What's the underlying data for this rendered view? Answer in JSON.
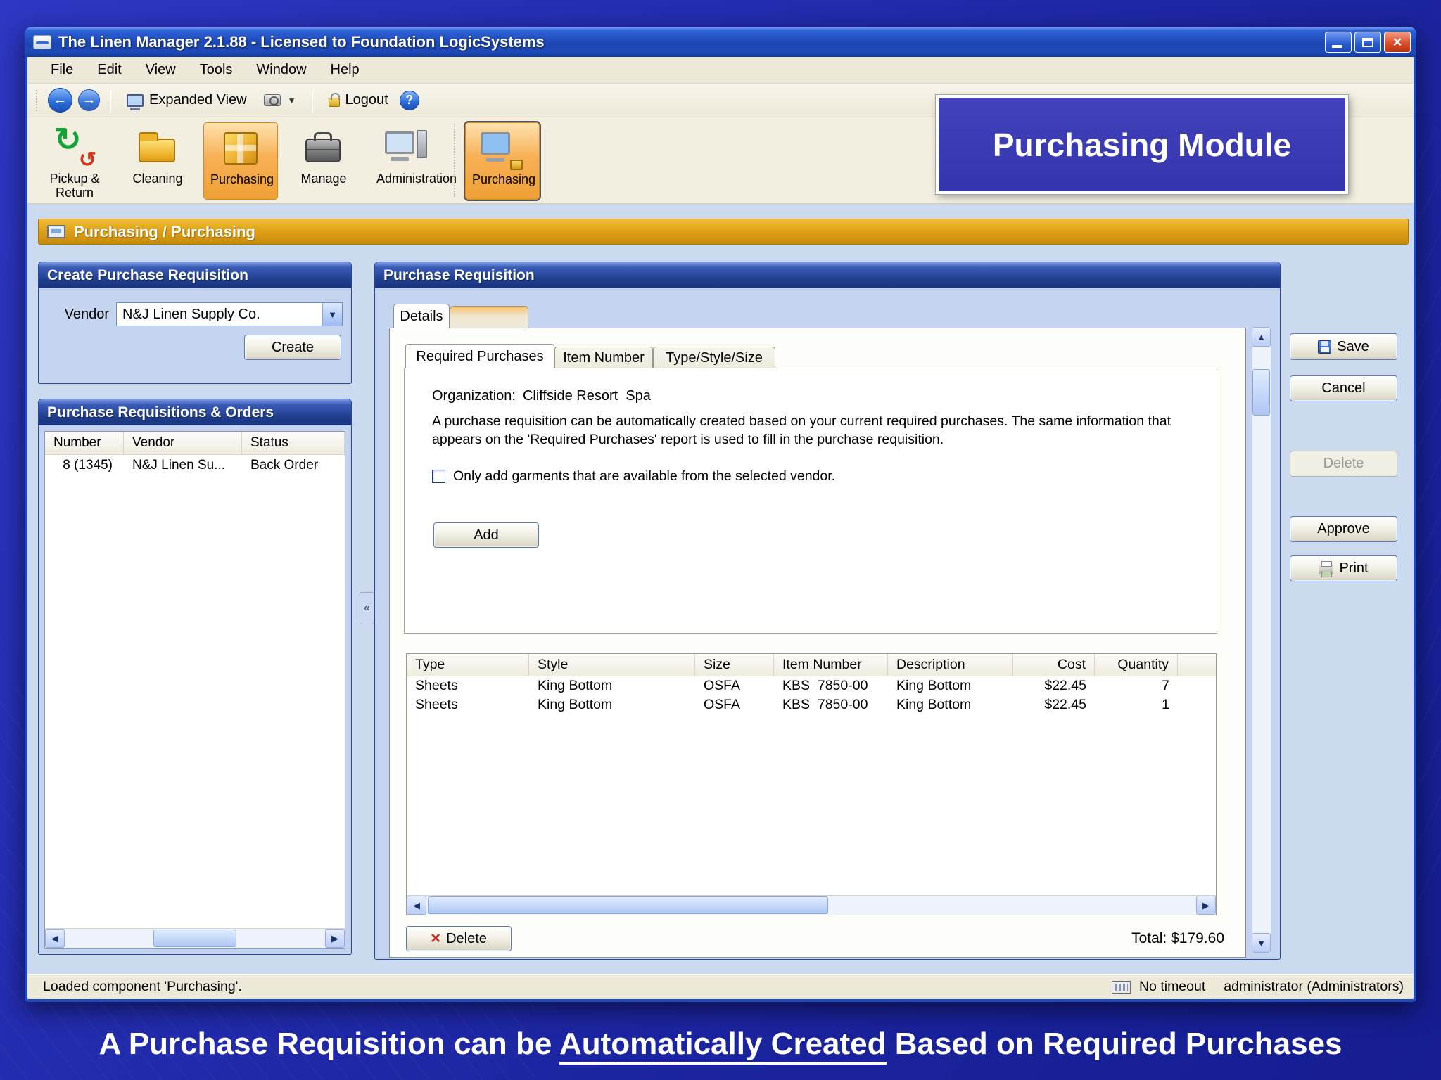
{
  "window": {
    "title": "The Linen Manager 2.1.88 - Licensed to Foundation LogicSystems"
  },
  "menu": {
    "items": [
      "File",
      "Edit",
      "View",
      "Tools",
      "Window",
      "Help"
    ]
  },
  "toolbar": {
    "expanded_view_label": "Expanded View",
    "logout_label": "Logout"
  },
  "modules": {
    "labels": [
      "Pickup & Return",
      "Cleaning",
      "Purchasing",
      "Manage",
      "Administration",
      "Purchasing"
    ]
  },
  "banner": {
    "text": "Purchasing Module"
  },
  "breadcrumb": {
    "text": "Purchasing / Purchasing"
  },
  "create_panel": {
    "title": "Create Purchase Requisition",
    "vendor_label": "Vendor",
    "vendor_value": "N&J Linen Supply Co.",
    "create_label": "Create"
  },
  "requisitions_panel": {
    "title": "Purchase Requisitions & Orders",
    "columns": [
      "Number",
      "Vendor",
      "Status"
    ],
    "rows": [
      [
        "8 (1345)",
        "N&J Linen Su...",
        "Back Order"
      ]
    ]
  },
  "requisition_panel": {
    "title": "Purchase Requisition",
    "tab_label": "Details",
    "inner_tabs": [
      "Required Purchases",
      "Item Number",
      "Type/Style/Size"
    ],
    "organization_label": "Organization:",
    "organization_value": "Cliffside Resort  Spa",
    "description": "A purchase requisition can be automatically created based on your current required purchases. The same information that appears on the 'Required Purchases' report is used to fill in the purchase requisition.",
    "checkbox_label": "Only add garments that are available from the selected vendor.",
    "add_label": "Add",
    "items": {
      "columns": [
        "Type",
        "Style",
        "Size",
        "Item Number",
        "Description",
        "Cost",
        "Quantity"
      ],
      "rows": [
        [
          "Sheets",
          "King Bottom",
          "OSFA",
          "KBS  7850-00",
          "King Bottom",
          "$22.45",
          "7"
        ],
        [
          "Sheets",
          "King Bottom",
          "OSFA",
          "KBS  7850-00",
          "King Bottom",
          "$22.45",
          "1"
        ]
      ]
    },
    "delete_label": "Delete",
    "total_text": "Total: $179.60"
  },
  "actions": {
    "save": "Save",
    "cancel": "Cancel",
    "delete": "Delete",
    "approve": "Approve",
    "print": "Print"
  },
  "statusbar": {
    "left": "Loaded component 'Purchasing'.",
    "timeout": "No timeout",
    "user": "administrator (Administrators)"
  },
  "caption": {
    "prefix": "A Purchase Requisition can be ",
    "underlined": "Automatically Created",
    "suffix": " Based on Required Purchases"
  }
}
